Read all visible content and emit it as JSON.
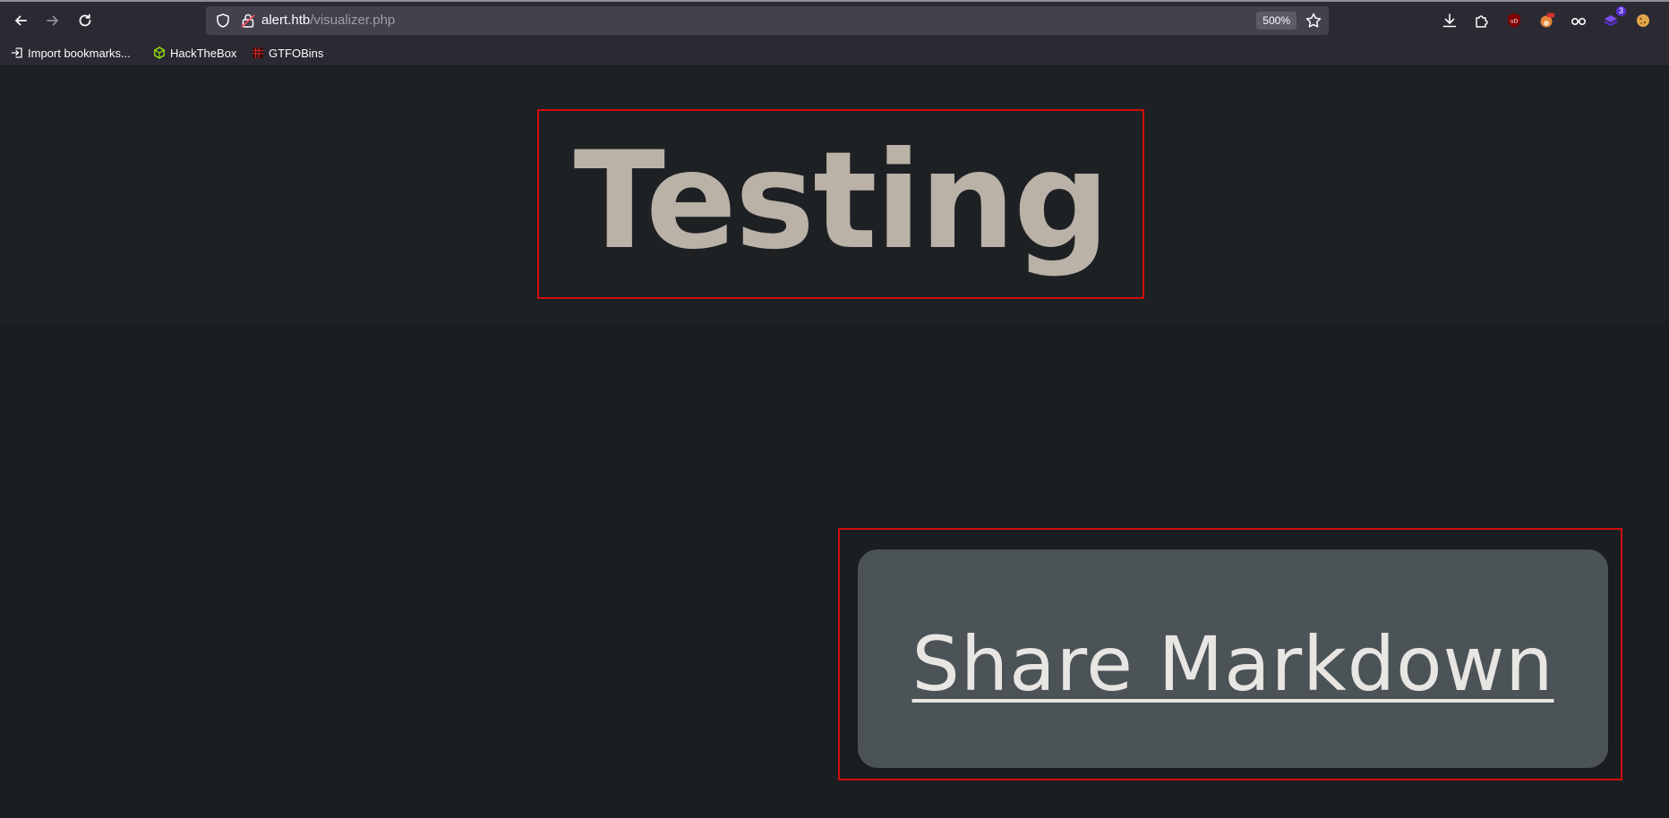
{
  "browser": {
    "url_host": "alert.htb",
    "url_path": "/visualizer.php",
    "zoom": "500%",
    "extension_badge": "3"
  },
  "bookmarks": [
    {
      "label": "Import bookmarks...",
      "icon": "import-icon"
    },
    {
      "label": "HackTheBox",
      "icon": "hackthebox-icon"
    },
    {
      "label": "GTFOBins",
      "icon": "gtfobins-icon"
    }
  ],
  "page": {
    "heading": "Testing",
    "share_label": "Share Markdown"
  },
  "colors": {
    "page_bg": "#1b1e20",
    "heading": "#bab1a7",
    "highlight_border": "#d20d0d",
    "button_bg": "#4c5357"
  }
}
